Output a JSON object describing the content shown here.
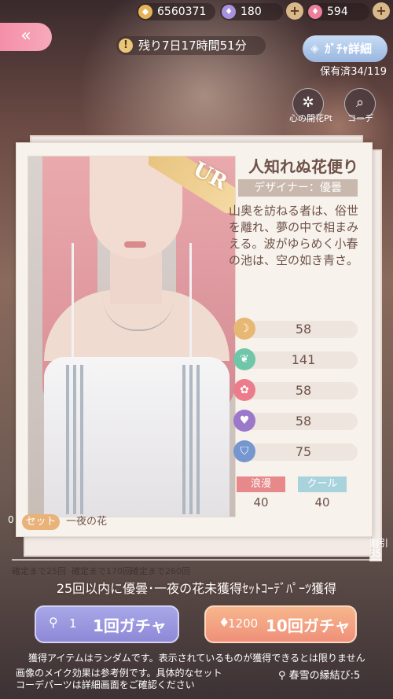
{
  "top": {
    "coins": "6560371",
    "diamonds": "180",
    "pink_diamonds": "594",
    "back": "«"
  },
  "timer": {
    "icon": "!",
    "text": "残り7日17時間51分"
  },
  "gacha_detail": {
    "icon": "◈",
    "label": "ｶﾞﾁｬ詳細"
  },
  "owned": "保有済34/119",
  "side": {
    "heart_pt": "心の開花Pt",
    "coordinate": "コーデ"
  },
  "item": {
    "rarity": "UR",
    "name": "人知れぬ花便り",
    "designer": "デザイナー：優曇",
    "description": "山奥を訪ねる者は、俗世を離れ、夢の中で相まみえる。波がゆらめく小春の池は、空の如き青さ。",
    "stats": [
      {
        "icon": "moon-icon",
        "value": "58",
        "color": "#e7b774"
      },
      {
        "icon": "leaf-icon",
        "value": "141",
        "color": "#6fc6a8"
      },
      {
        "icon": "flower-icon",
        "value": "58",
        "color": "#ec7c8c"
      },
      {
        "icon": "heart-icon",
        "value": "58",
        "color": "#9b78c9"
      },
      {
        "icon": "shield-icon",
        "value": "75",
        "color": "#7596cf"
      }
    ],
    "styles": [
      {
        "label": "浪漫",
        "value": "40"
      },
      {
        "label": "クール",
        "value": "40"
      }
    ],
    "set_tag": "セット",
    "set_name": "一夜の花"
  },
  "side_right": {
    "pct": "割引",
    "count": "35"
  },
  "left_num": "0",
  "progress": [
    "確定まで25回",
    "確定まで170回",
    "確定まで260回"
  ],
  "banner": "25回以内に優曇･一夜の花未獲得ｾｯﾄｺｰﾃﾞﾊﾟｰﾂ獲得",
  "buttons": {
    "single": {
      "cost": "1",
      "label": "1回ガチャ"
    },
    "multi": {
      "cost": "1200",
      "label": "10回ガチャ"
    }
  },
  "notes": {
    "line1": "獲得アイテムはランダムです。表示されているものが獲得できるとは限りません",
    "line2": "画像のメイク効果は参考例です。具体的なセット",
    "line3": "コーデパーツは詳細画面をご確認ください"
  },
  "ticket": "春雪の縁結び:5"
}
